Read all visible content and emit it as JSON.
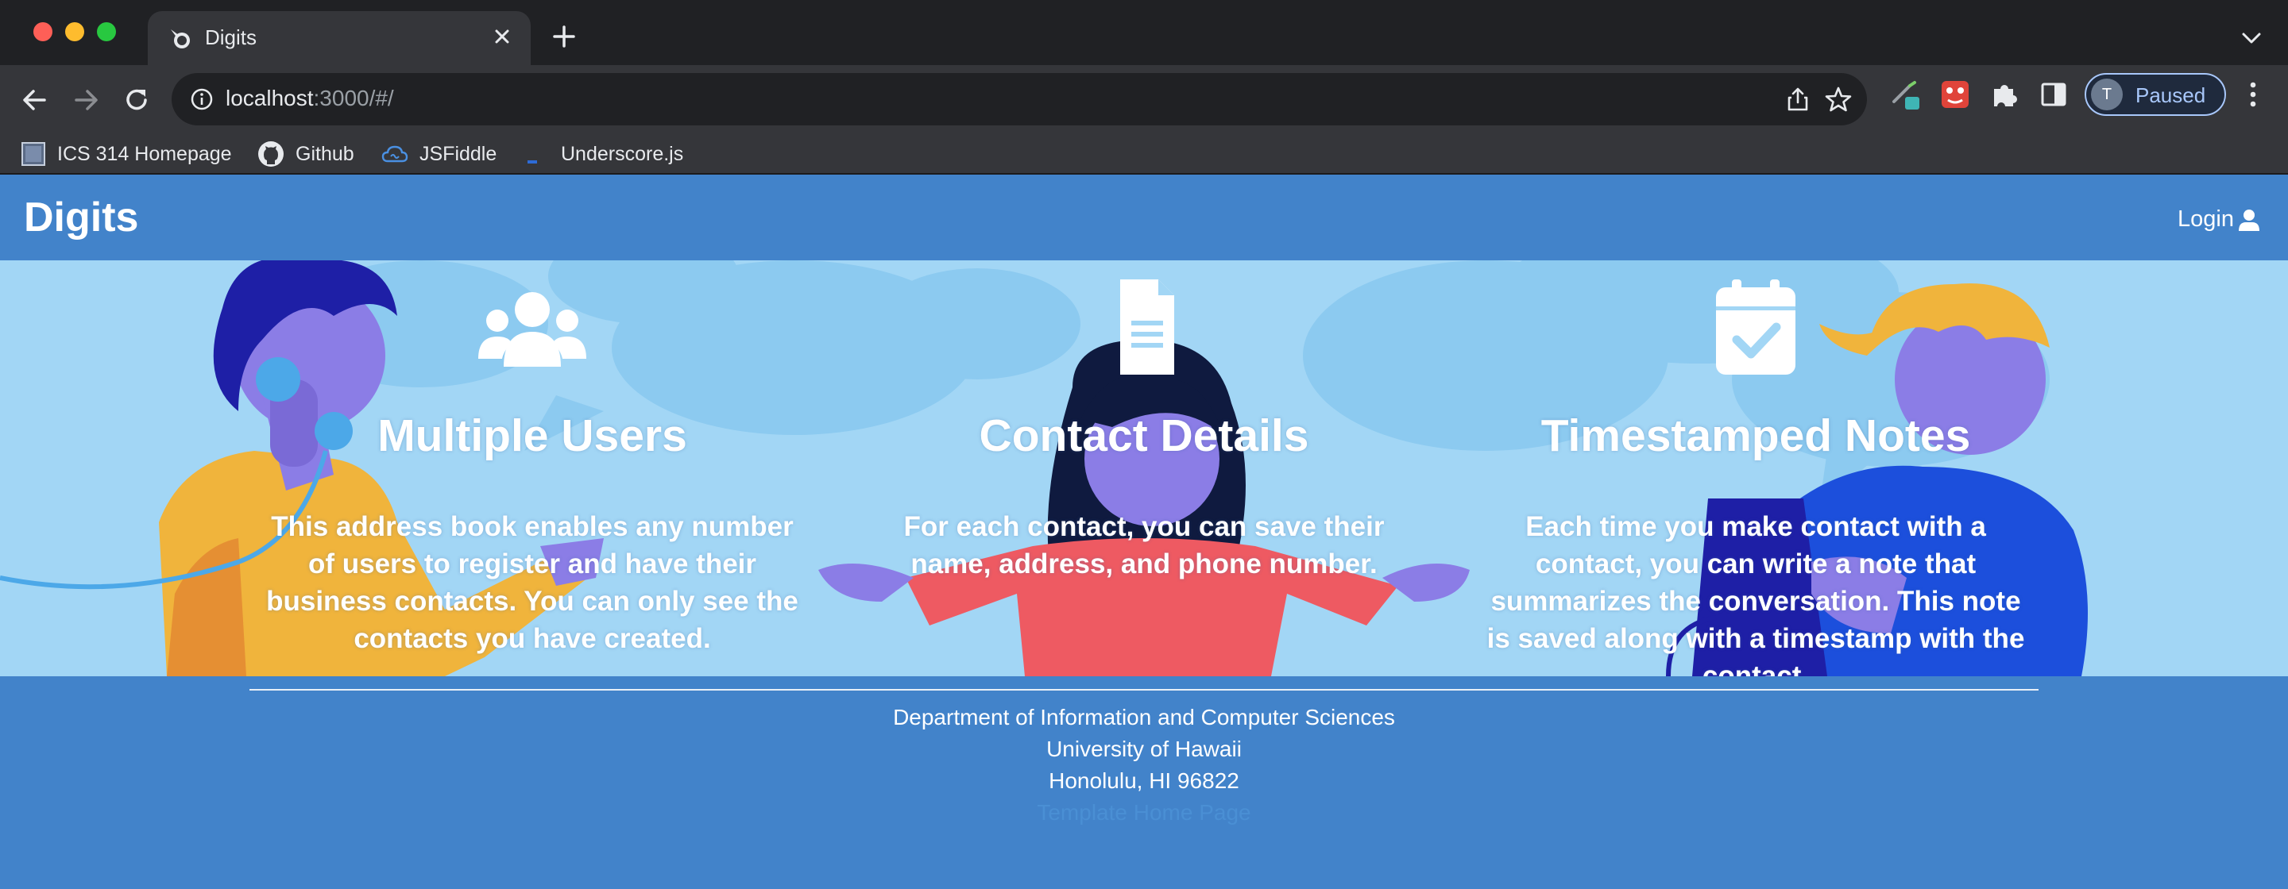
{
  "browser": {
    "tab_title": "Digits",
    "url_host": "localhost",
    "url_rest": ":3000/#/",
    "profile_initial": "T",
    "profile_label": "Paused",
    "bookmarks": [
      {
        "label": "ICS 314 Homepage",
        "icon": "page-icon"
      },
      {
        "label": "Github",
        "icon": "github-icon"
      },
      {
        "label": "JSFiddle",
        "icon": "jsfiddle-icon"
      },
      {
        "label": "Underscore.js",
        "icon": "underscore-icon"
      }
    ],
    "extensions": [
      "pen-extension-icon",
      "red-extension-icon",
      "puzzle-icon",
      "sidepanel-icon"
    ]
  },
  "navbar": {
    "brand": "Digits",
    "login_label": "Login",
    "login_icon": "user-icon"
  },
  "hero": {
    "columns": [
      {
        "icon": "users-icon",
        "title": "Multiple Users",
        "text": "This address book enables any number of users to register and have their business contacts. You can only see the contacts you have created."
      },
      {
        "icon": "file-icon",
        "title": "Contact Details",
        "text": "For each contact, you can save their name, address, and phone number."
      },
      {
        "icon": "calendar-check-icon",
        "title": "Timestamped Notes",
        "text": "Each time you make contact with a contact, you can write a note that summarizes the conversation. This note is saved along with a timestamp with the contact."
      }
    ]
  },
  "footer": {
    "line1": "Department of Information and Computer Sciences",
    "line2": "University of Hawaii",
    "line3": "Honolulu, HI 96822",
    "line4": "Template Home Page"
  },
  "colors": {
    "primary": "#4283ca",
    "hero_bg": "#a2d6f5",
    "chrome_dark": "#202124",
    "chrome_mid": "#35363a"
  }
}
